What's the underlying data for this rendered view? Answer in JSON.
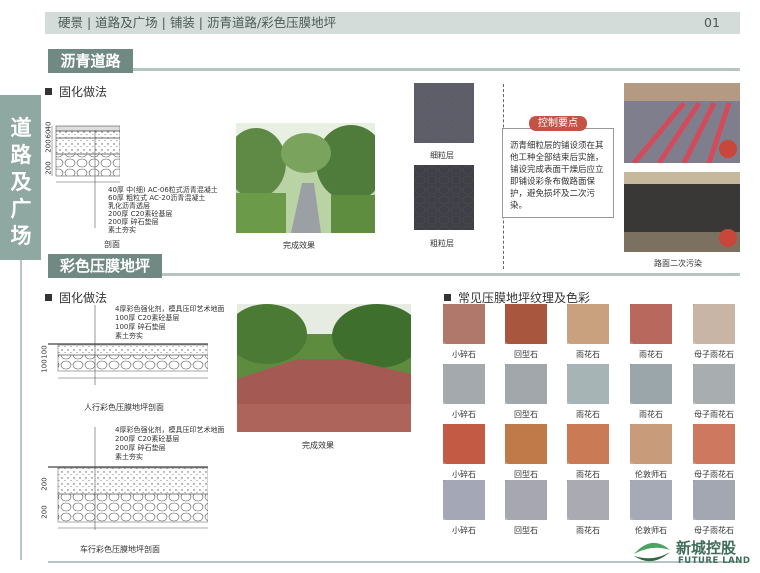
{
  "header": {
    "title": "硬景 | 道路及广场 | 铺装 | 沥青道路/彩色压膜地坪",
    "page": "01"
  },
  "side_label": [
    "道",
    "路",
    "及",
    "广",
    "场"
  ],
  "section_asphalt": {
    "title": "沥青道路",
    "sub": "固化做法",
    "layers": [
      "40厚 中(细) AC-06粒式沥青混凝土",
      "60厚 粗粒式 AC-20沥青混凝土",
      "乳化沥青透层",
      "200厚 C20素砼基层",
      "200厚 碎石垫层",
      "素土夯实"
    ],
    "dims": [
      "40",
      "60",
      "200",
      "200"
    ],
    "caption_section": "剖面",
    "caption_photo": "完成效果",
    "fine_label": "细粒层",
    "coarse_label": "粗粒层",
    "key_title": "控制要点",
    "key_text": "沥青细粒层的铺设须在其他工种全部结束后实施，铺设完成表面干燥后应立即铺设彩条布做路面保护，避免损坏及二次污染。",
    "stain_caption": "路面二次污染"
  },
  "section_color": {
    "title": "彩色压膜地坪",
    "sub": "固化做法",
    "ped_layers": [
      "4厚彩色强化剂，模具压印艺术地面",
      "100厚 C20素砼基层",
      "100厚 碎石垫层",
      "素土夯实"
    ],
    "ped_dims": [
      "100",
      "100"
    ],
    "ped_caption": "人行彩色压膜地坪剖面",
    "photo_caption": "完成效果",
    "veh_layers": [
      "4厚彩色强化剂，模具压印艺术地面",
      "200厚 C20素砼基层",
      "200厚 碎石垫层",
      "素土夯实"
    ],
    "veh_dims": [
      "200",
      "200"
    ],
    "veh_caption": "车行彩色压膜地坪剖面"
  },
  "textures": {
    "sub": "常见压膜地坪纹理及色彩",
    "rows": [
      [
        "小碎石",
        "回型石",
        "雨花石",
        "雨花石",
        "母子雨花石"
      ],
      [
        "小碎石",
        "回型石",
        "雨花石",
        "雨花石",
        "母子雨花石"
      ],
      [
        "小碎石",
        "回型石",
        "雨花石",
        "伦敦师石",
        "母子雨花石"
      ],
      [
        "小碎石",
        "回型石",
        "雨花石",
        "伦敦师石",
        "母子雨花石"
      ]
    ],
    "colors": [
      [
        "#b0786a",
        "#a8563e",
        "#c9a17f",
        "#b8685d",
        "#c9b5a5"
      ],
      [
        "#a3a9ad",
        "#a2a7ab",
        "#a7b4b6",
        "#9aa6aa",
        "#a8adb0"
      ],
      [
        "#c25a44",
        "#c07a4a",
        "#ca7a55",
        "#c89b7a",
        "#cf7860"
      ],
      [
        "#a4a8b6",
        "#a7a7b2",
        "#a9aab2",
        "#a6aab6",
        "#a3a7b1"
      ]
    ]
  },
  "brand": {
    "cn": "新城控股",
    "en": "FUTURE LAND",
    "accent": "#708a83"
  }
}
